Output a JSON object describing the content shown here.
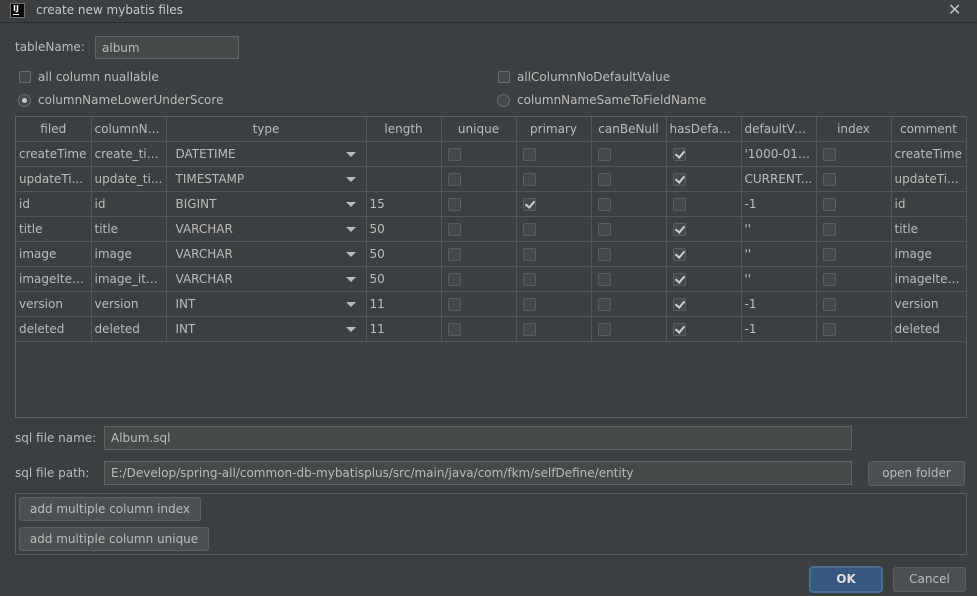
{
  "window": {
    "title": "create new mybatis files"
  },
  "table_name": {
    "label": "tableName:",
    "value": "album"
  },
  "options": {
    "all_column_nullable": "all column nuallable",
    "all_column_no_default": "allColumnNoDefaultValue",
    "lower_under_score": "columnNameLowerUnderScore",
    "same_to_field": "columnNameSameToFieldName",
    "selected_naming": "columnNameLowerUnderScore"
  },
  "columns_table": {
    "headers": [
      "filed",
      "columnNa...",
      "type",
      "length",
      "unique",
      "primary",
      "canBeNull",
      "hasDefault...",
      "defaultValue",
      "index",
      "comment"
    ],
    "rows": [
      {
        "filed": "createTime",
        "columnName": "create_time",
        "type": "DATETIME",
        "length": "",
        "unique": false,
        "primary": false,
        "canBeNull": false,
        "hasDefault": true,
        "defaultValue": "'1000-01-...",
        "index": false,
        "comment": "createTime"
      },
      {
        "filed": "updateTi...",
        "columnName": "update_ti...",
        "type": "TIMESTAMP",
        "length": "",
        "unique": false,
        "primary": false,
        "canBeNull": false,
        "hasDefault": true,
        "defaultValue": "CURRENT...",
        "index": false,
        "comment": "updateTi..."
      },
      {
        "filed": "id",
        "columnName": "id",
        "type": "BIGINT",
        "length": "15",
        "unique": false,
        "primary": true,
        "canBeNull": false,
        "hasDefault": false,
        "defaultValue": "-1",
        "index": false,
        "comment": "id"
      },
      {
        "filed": "title",
        "columnName": "title",
        "type": "VARCHAR",
        "length": "50",
        "unique": false,
        "primary": false,
        "canBeNull": false,
        "hasDefault": true,
        "defaultValue": "''",
        "index": false,
        "comment": "title"
      },
      {
        "filed": "image",
        "columnName": "image",
        "type": "VARCHAR",
        "length": "50",
        "unique": false,
        "primary": false,
        "canBeNull": false,
        "hasDefault": true,
        "defaultValue": "''",
        "index": false,
        "comment": "image"
      },
      {
        "filed": "imageItems",
        "columnName": "image_ite...",
        "type": "VARCHAR",
        "length": "50",
        "unique": false,
        "primary": false,
        "canBeNull": false,
        "hasDefault": true,
        "defaultValue": "''",
        "index": false,
        "comment": "imageItems"
      },
      {
        "filed": "version",
        "columnName": "version",
        "type": "INT",
        "length": "11",
        "unique": false,
        "primary": false,
        "canBeNull": false,
        "hasDefault": true,
        "defaultValue": "-1",
        "index": false,
        "comment": "version"
      },
      {
        "filed": "deleted",
        "columnName": "deleted",
        "type": "INT",
        "length": "11",
        "unique": false,
        "primary": false,
        "canBeNull": false,
        "hasDefault": true,
        "defaultValue": "-1",
        "index": false,
        "comment": "deleted"
      }
    ]
  },
  "sql_file_name": {
    "label": "sql file name:",
    "value": "Album.sql"
  },
  "sql_file_path": {
    "label": "sql file path:",
    "value": "E:/Develop/spring-all/common-db-mybatisplus/src/main/java/com/fkm/selfDefine/entity"
  },
  "buttons": {
    "open_folder": "open folder",
    "add_index": "add multiple column index",
    "add_unique": "add multiple column unique",
    "ok": "OK",
    "cancel": "Cancel"
  },
  "colors": {
    "background": "#3c3f41",
    "field": "#45494a",
    "ok_button": "#365880",
    "text": "#bbbbbb"
  }
}
